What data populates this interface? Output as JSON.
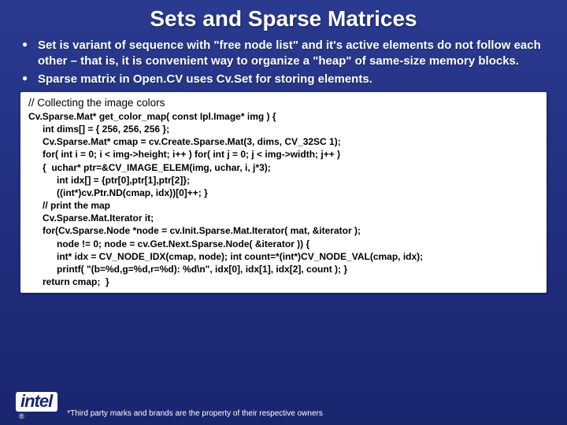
{
  "title": "Sets and Sparse Matrices",
  "bullets": [
    "Set is variant of sequence with \"free node list\" and it's active elements do not follow each other – that is, it is convenient way to organize a \"heap\" of same-size memory blocks.",
    "Sparse matrix in Open.CV uses Cv.Set for storing elements."
  ],
  "code": {
    "comment": "// Collecting the image colors",
    "lines": [
      {
        "t": "Cv.Sparse.Mat* get_color_map( const Ipl.Image* img ) {",
        "i": 0
      },
      {
        "t": "int dims[] = { 256, 256, 256 };",
        "i": 1
      },
      {
        "t": "Cv.Sparse.Mat* cmap = cv.Create.Sparse.Mat(3, dims, CV_32SC 1);",
        "i": 1
      },
      {
        "t": "for( int i = 0; i < img->height; i++ ) for( int j = 0; j < img->width; j++ )",
        "i": 1
      },
      {
        "t": "{  uchar* ptr=&CV_IMAGE_ELEM(img, uchar, i, j*3);",
        "i": 1
      },
      {
        "t": "int idx[] = {ptr[0],ptr[1],ptr[2]};",
        "i": 2
      },
      {
        "t": "((int*)cv.Ptr.ND(cmap, idx))[0]++; }",
        "i": 2
      },
      {
        "t": "// print the map",
        "i": 1
      },
      {
        "t": "Cv.Sparse.Mat.Iterator it;",
        "i": 1
      },
      {
        "t": "for(Cv.Sparse.Node *node = cv.Init.Sparse.Mat.Iterator( mat, &iterator );",
        "i": 1
      },
      {
        "t": "node != 0; node = cv.Get.Next.Sparse.Node( &iterator )) {",
        "i": 2
      },
      {
        "t": "int* idx = CV_NODE_IDX(cmap, node); int count=*(int*)CV_NODE_VAL(cmap, idx);",
        "i": 2
      },
      {
        "t": "printf( \"(b=%d,g=%d,r=%d): %d\\n\", idx[0], idx[1], idx[2], count ); }",
        "i": 2
      },
      {
        "t": "return cmap;  }",
        "i": 1
      }
    ]
  },
  "logo_text": "intel",
  "reg_mark": "®",
  "footnote": "*Third party marks and brands are the property of their respective owners"
}
